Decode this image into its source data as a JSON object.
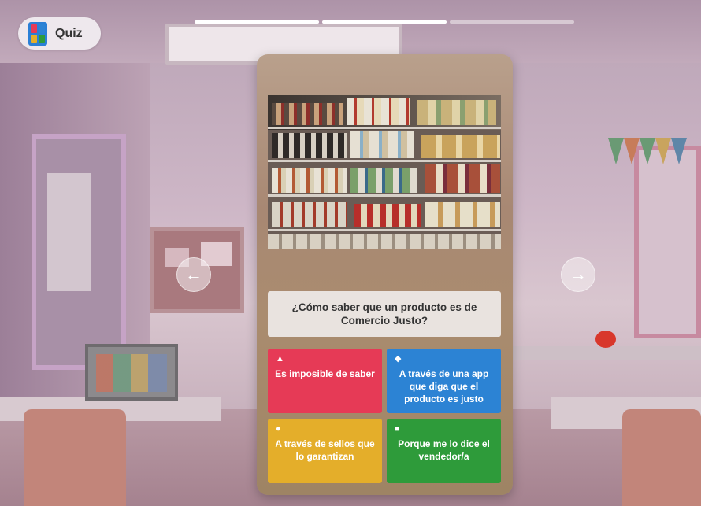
{
  "app": {
    "name": "Quiz"
  },
  "progress": {
    "segments": 3,
    "completed": 2
  },
  "question": {
    "text": "¿Cómo saber que un producto es de Comercio Justo?"
  },
  "answers": [
    {
      "label": "Es imposible de saber",
      "shape": "triangle-icon",
      "symbol": "▲",
      "color": "#e63a56"
    },
    {
      "label": "A través de una app que diga que el producto es justo",
      "shape": "diamond-icon",
      "symbol": "◆",
      "color": "#2c83d4"
    },
    {
      "label": "A través de sellos que lo garantizan",
      "shape": "circle-icon",
      "symbol": "●",
      "color": "#e4ae2a"
    },
    {
      "label": "Porque me lo dice el vendedor/a",
      "shape": "square-icon",
      "symbol": "■",
      "color": "#2e9b3a"
    }
  ],
  "nav": {
    "prev_symbol": "←",
    "next_symbol": "→"
  },
  "colors": {
    "card": "#a88873",
    "question_bg": "#e9e3df",
    "progress_done": "#ffffff",
    "progress_todo": "#e6dde3"
  }
}
